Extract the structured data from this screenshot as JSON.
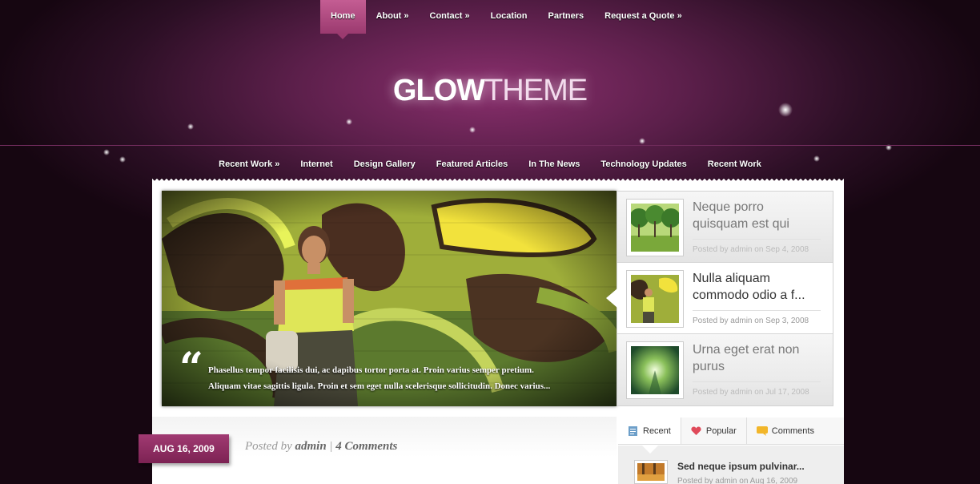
{
  "top_nav": [
    {
      "label": "Home"
    },
    {
      "label": "About »"
    },
    {
      "label": "Contact »"
    },
    {
      "label": "Location"
    },
    {
      "label": "Partners"
    },
    {
      "label": "Request a Quote »"
    }
  ],
  "logo": {
    "part1": "GLOW",
    "part2": "THEME"
  },
  "category_nav": [
    {
      "label": "Recent Work »"
    },
    {
      "label": "Internet"
    },
    {
      "label": "Design Gallery"
    },
    {
      "label": "Featured Articles"
    },
    {
      "label": "In The News"
    },
    {
      "label": "Technology Updates"
    },
    {
      "label": "Recent Work"
    }
  ],
  "featured": {
    "quote_mark": "“",
    "caption_line1": "Phasellus tempor facilisis dui, ac dapibus tortor porta at. Proin varius semper pretium.",
    "caption_line2": "Aliquam vitae sagittis ligula. Proin et sem eget nulla scelerisque sollicitudin. Donec varius..."
  },
  "thumbs": [
    {
      "title": "Neque porro quisquam est qui",
      "meta": "Posted by admin on Sep 4, 2008"
    },
    {
      "title": "Nulla aliquam commodo odio a f...",
      "meta": "Posted by admin on Sep 3, 2008"
    },
    {
      "title": "Urna eget erat non purus",
      "meta": "Posted by admin on Jul 17, 2008"
    }
  ],
  "post": {
    "date": "AUG 16, 2009",
    "posted_by": "Posted by",
    "author": "admin",
    "separator": "|",
    "comments": "4 Comments"
  },
  "sidebar": {
    "tabs": [
      {
        "label": "Recent",
        "icon": "document-icon"
      },
      {
        "label": "Popular",
        "icon": "heart-icon"
      },
      {
        "label": "Comments",
        "icon": "speech-bubble-icon"
      }
    ],
    "recent_title": "Sed neque ipsum pulvinar...",
    "recent_meta": "Posted by admin on Aug 16, 2009"
  },
  "colors": {
    "accent": "#9b3a6f",
    "background": "#2c0f25"
  }
}
